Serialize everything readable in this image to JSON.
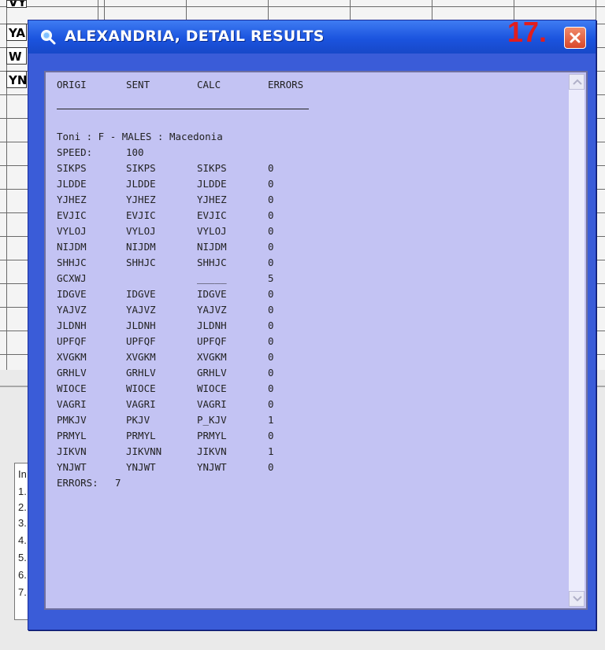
{
  "window": {
    "title": "ALEXANDRIA, DETAIL RESULTS",
    "step_label": "17."
  },
  "background": {
    "cells": [
      "VYLOJ",
      "YA",
      "W",
      "YN"
    ],
    "list_items": [
      "In",
      "1.",
      "2.",
      "3.",
      "4.",
      "5.",
      "6.",
      "7."
    ]
  },
  "results": {
    "headers": [
      "ORIGI",
      "SENT",
      "CALC",
      "ERRORS"
    ],
    "info_line": "Toni : F - MALES : Macedonia",
    "speed_label": "SPEED:",
    "speed_value": "100",
    "rows": [
      {
        "orig": "SIKPS",
        "sent": "SIKPS",
        "calc": "SIKPS",
        "errors": "0"
      },
      {
        "orig": "JLDDE",
        "sent": "JLDDE",
        "calc": "JLDDE",
        "errors": "0"
      },
      {
        "orig": "YJHEZ",
        "sent": "YJHEZ",
        "calc": "YJHEZ",
        "errors": "0"
      },
      {
        "orig": "EVJIC",
        "sent": "EVJIC",
        "calc": "EVJIC",
        "errors": "0"
      },
      {
        "orig": "VYLOJ",
        "sent": "VYLOJ",
        "calc": "VYLOJ",
        "errors": "0"
      },
      {
        "orig": "NIJDM",
        "sent": "NIJDM",
        "calc": "NIJDM",
        "errors": "0"
      },
      {
        "orig": "SHHJC",
        "sent": "SHHJC",
        "calc": "SHHJC",
        "errors": "0"
      },
      {
        "orig": "GCXWJ",
        "sent": "",
        "calc": "_____",
        "errors": "5"
      },
      {
        "orig": "IDGVE",
        "sent": "IDGVE",
        "calc": "IDGVE",
        "errors": "0"
      },
      {
        "orig": "YAJVZ",
        "sent": "YAJVZ",
        "calc": "YAJVZ",
        "errors": "0"
      },
      {
        "orig": "JLDNH",
        "sent": "JLDNH",
        "calc": "JLDNH",
        "errors": "0"
      },
      {
        "orig": "UPFQF",
        "sent": "UPFQF",
        "calc": "UPFQF",
        "errors": "0"
      },
      {
        "orig": "XVGKM",
        "sent": "XVGKM",
        "calc": "XVGKM",
        "errors": "0"
      },
      {
        "orig": "GRHLV",
        "sent": "GRHLV",
        "calc": "GRHLV",
        "errors": "0"
      },
      {
        "orig": "WIOCE",
        "sent": "WIOCE",
        "calc": "WIOCE",
        "errors": "0"
      },
      {
        "orig": "VAGRI",
        "sent": "VAGRI",
        "calc": "VAGRI",
        "errors": "0"
      },
      {
        "orig": "PMKJV",
        "sent": "PKJV",
        "calc": "P_KJV",
        "errors": "1"
      },
      {
        "orig": "PRMYL",
        "sent": "PRMYL",
        "calc": "PRMYL",
        "errors": "0"
      },
      {
        "orig": "JIKVN",
        "sent": "JIKVNN",
        "calc": "JIKVN",
        "errors": "1"
      },
      {
        "orig": "YNJWT",
        "sent": "YNJWT",
        "calc": "YNJWT",
        "errors": "0"
      }
    ],
    "errors_label": "ERRORS:",
    "errors_total": "7"
  },
  "colors": {
    "window_frame": "#3a5cd8",
    "titlebar": "#1b54df",
    "text_area": "#c3c3f3",
    "step_label": "#e11d1d"
  },
  "icons": {
    "title": "magnifier-icon",
    "close": "close-icon",
    "scroll_up": "scroll-up-arrow-icon",
    "scroll_down": "scroll-down-arrow-icon"
  }
}
